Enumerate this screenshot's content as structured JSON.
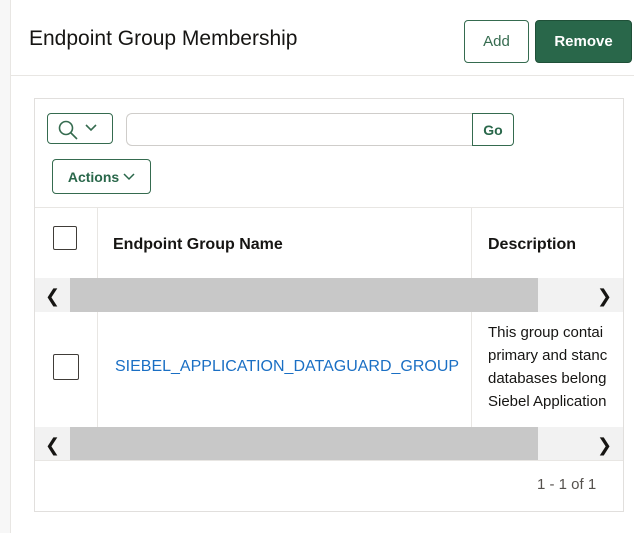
{
  "header": {
    "title": "Endpoint Group Membership",
    "add_label": "Add",
    "remove_label": "Remove"
  },
  "toolbar": {
    "search_placeholder": "",
    "go_label": "Go",
    "actions_label": "Actions"
  },
  "table": {
    "columns": [
      "Endpoint Group Name",
      "Description"
    ],
    "rows": [
      {
        "name": "SIEBEL_APPLICATION_DATAGUARD_GROUP",
        "description_lines": [
          "This group contai",
          "primary and stanc",
          "databases belong",
          "Siebel Application"
        ]
      }
    ]
  },
  "pagination": {
    "text": "1 - 1 of 1"
  },
  "colors": {
    "accent": "#29674a",
    "link": "#1a6fc4"
  }
}
